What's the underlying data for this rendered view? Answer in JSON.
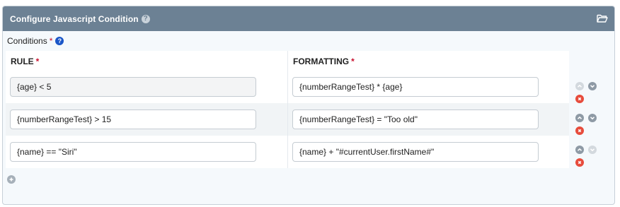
{
  "panel": {
    "title": "Configure Javascript Condition",
    "help_icon": "question-circle-icon",
    "header_icon": "folder-open-icon"
  },
  "conditions": {
    "label": "Conditions",
    "required_mark": "*",
    "help_icon": "question-circle-icon"
  },
  "table": {
    "headers": {
      "rule": "RULE",
      "formatting": "FORMATTING",
      "required_mark": "*"
    },
    "rows": [
      {
        "rule": "{age} < 5",
        "formatting": "{numberRangeTest} * {age}",
        "rule_disabled": true,
        "up_enabled": false,
        "down_enabled": true
      },
      {
        "rule": "{numberRangeTest} > 15",
        "formatting": "{numberRangeTest} = \"Too old\"",
        "rule_disabled": false,
        "up_enabled": true,
        "down_enabled": true
      },
      {
        "rule": "{name} == \"Siri\"",
        "formatting": "{name} + \"#currentUser.firstName#\"",
        "rule_disabled": false,
        "up_enabled": true,
        "down_enabled": false
      }
    ]
  },
  "icons": {
    "move_up": "chevron-up-icon",
    "move_down": "chevron-down-icon",
    "remove": "remove-circle-icon",
    "add": "add-circle-icon"
  },
  "colors": {
    "header_bg": "#6c8194",
    "required": "#c8102e",
    "help": "#1a56c8",
    "remove": "#e74c3c"
  }
}
